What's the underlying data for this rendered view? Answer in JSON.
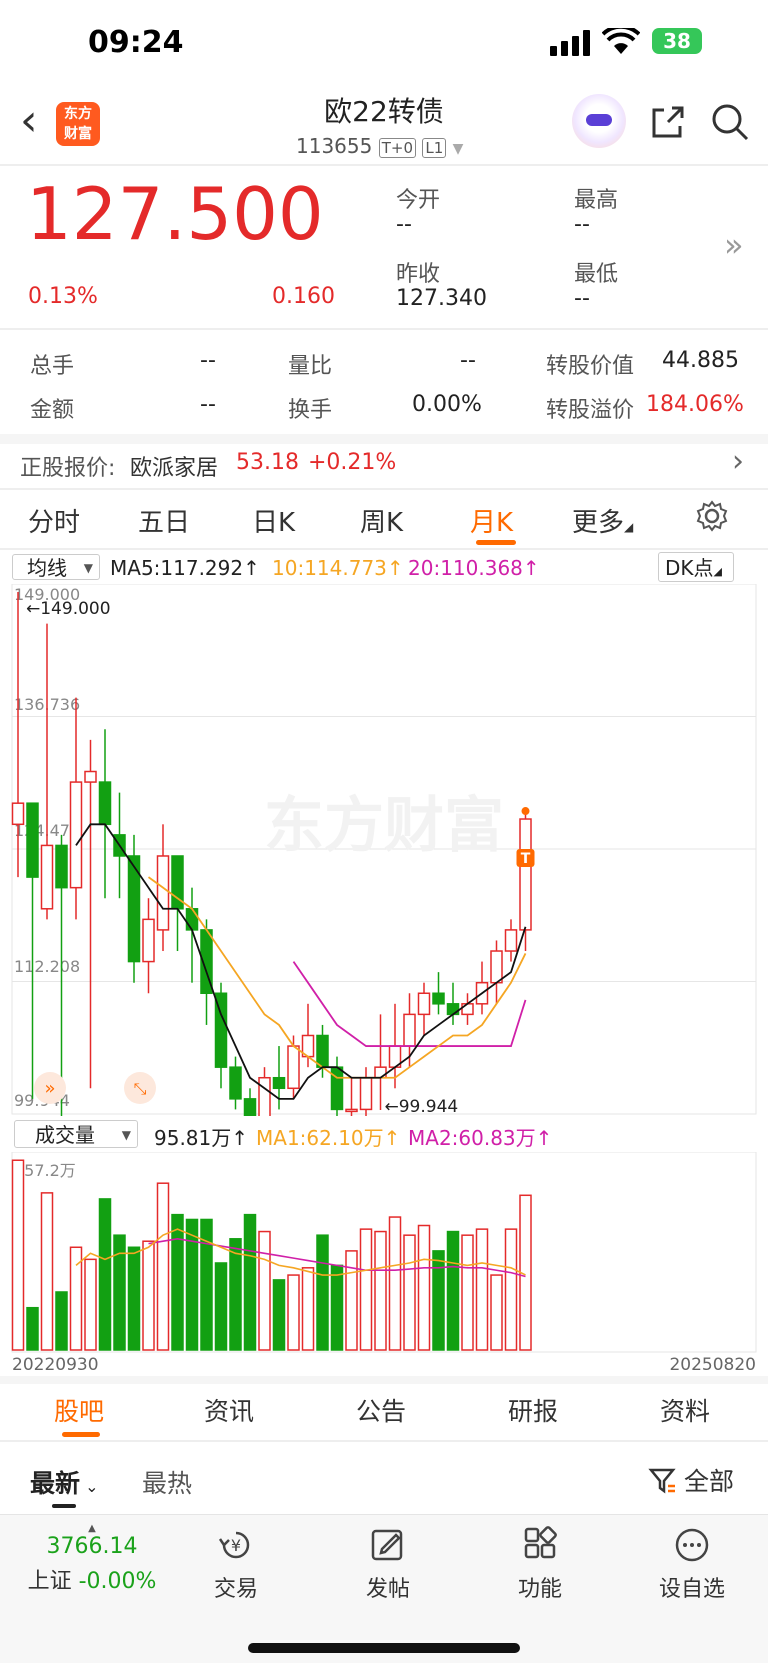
{
  "status_bar": {
    "time": "09:24",
    "battery": "38"
  },
  "header": {
    "title": "欧22转债",
    "code": "113655",
    "badge1": "T+0",
    "badge2": "L1",
    "logo_line1": "东方",
    "logo_line2": "财富"
  },
  "quote": {
    "price": "127.500",
    "pct": "0.13%",
    "change": "0.160",
    "open_label": "今开",
    "open": "--",
    "high_label": "最高",
    "high": "--",
    "prev_label": "昨收",
    "prev": "127.340",
    "low_label": "最低",
    "low": "--"
  },
  "stats": {
    "vol_label": "总手",
    "vol": "--",
    "ratio_label": "量比",
    "ratio": "--",
    "conv_value_label": "转股价值",
    "conv_value": "44.885",
    "amount_label": "金额",
    "amount": "--",
    "turnover_label": "换手",
    "turnover": "0.00%",
    "premium_label": "转股溢价",
    "premium": "184.06%"
  },
  "stock": {
    "label": "正股报价:",
    "name": "欧派家居",
    "price": "53.18",
    "change": "+0.21%"
  },
  "chart_tabs": [
    "分时",
    "五日",
    "日K",
    "周K",
    "月K",
    "更多"
  ],
  "ma_bar": {
    "select": "均线",
    "ma5": "MA5:117.292↑",
    "ma10": "10:114.773↑",
    "ma20": "20:110.368↑",
    "dk": "DK点"
  },
  "vol_bar": {
    "select": "成交量",
    "vol": "95.81万↑",
    "ma1": "MA1:62.10万↑",
    "ma2": "MA2:60.83万↑"
  },
  "colors": {
    "up": "#e42a2a",
    "down": "#12a012",
    "ma5": "#111111",
    "ma10": "#f5a623",
    "ma20": "#d020a8",
    "accent": "#ff6a00"
  },
  "chart_data": {
    "type": "candlestick",
    "yaxis_labels": [
      "149.000",
      "136.736",
      "124.472",
      "112.208",
      "99.944"
    ],
    "max_label": "149.000",
    "min_label": "99.944",
    "ylim": [
      99.944,
      149.0
    ],
    "start_date": "20220930",
    "end_date": "20250820",
    "vol_max_label": "157.2万",
    "candles": [
      {
        "o": 127,
        "c": 129,
        "h": 149,
        "l": 122
      },
      {
        "o": 129,
        "c": 122,
        "h": 128,
        "l": 101
      },
      {
        "o": 119,
        "c": 125,
        "h": 146,
        "l": 118
      },
      {
        "o": 125,
        "c": 121,
        "h": 126,
        "l": 99
      },
      {
        "o": 121,
        "c": 131,
        "h": 139,
        "l": 118
      },
      {
        "o": 131,
        "c": 132,
        "h": 135,
        "l": 102
      },
      {
        "o": 131,
        "c": 127,
        "h": 136,
        "l": 120
      },
      {
        "o": 126,
        "c": 124,
        "h": 130,
        "l": 120
      },
      {
        "o": 124,
        "c": 114,
        "h": 126,
        "l": 112
      },
      {
        "o": 114,
        "c": 118,
        "h": 120,
        "l": 111
      },
      {
        "o": 117,
        "c": 124,
        "h": 127,
        "l": 115
      },
      {
        "o": 124,
        "c": 119,
        "h": 124,
        "l": 115
      },
      {
        "o": 119,
        "c": 117,
        "h": 121,
        "l": 112
      },
      {
        "o": 117,
        "c": 111,
        "h": 118,
        "l": 108
      },
      {
        "o": 111,
        "c": 104,
        "h": 112,
        "l": 102
      },
      {
        "o": 104,
        "c": 101,
        "h": 105,
        "l": 100
      },
      {
        "o": 101,
        "c": 99,
        "h": 102,
        "l": 97
      },
      {
        "o": 99,
        "c": 103,
        "h": 104,
        "l": 98
      },
      {
        "o": 103,
        "c": 102,
        "h": 106,
        "l": 100
      },
      {
        "o": 102,
        "c": 106,
        "h": 107,
        "l": 101
      },
      {
        "o": 105,
        "c": 107,
        "h": 110,
        "l": 104
      },
      {
        "o": 107,
        "c": 104,
        "h": 108,
        "l": 103
      },
      {
        "o": 104,
        "c": 100,
        "h": 105,
        "l": 98
      },
      {
        "o": 100,
        "c": 100,
        "h": 103,
        "l": 99
      },
      {
        "o": 100,
        "c": 103,
        "h": 104,
        "l": 98
      },
      {
        "o": 103,
        "c": 104,
        "h": 109,
        "l": 99.944
      },
      {
        "o": 104,
        "c": 106,
        "h": 110,
        "l": 102
      },
      {
        "o": 106,
        "c": 109,
        "h": 111,
        "l": 104
      },
      {
        "o": 109,
        "c": 111,
        "h": 112,
        "l": 107
      },
      {
        "o": 111,
        "c": 110,
        "h": 113,
        "l": 109
      },
      {
        "o": 110,
        "c": 109,
        "h": 112,
        "l": 108
      },
      {
        "o": 109,
        "c": 110,
        "h": 111,
        "l": 108
      },
      {
        "o": 110,
        "c": 112,
        "h": 114,
        "l": 109
      },
      {
        "o": 112,
        "c": 115,
        "h": 116,
        "l": 110
      },
      {
        "o": 115,
        "c": 117,
        "h": 118,
        "l": 114
      },
      {
        "o": 117,
        "c": 127.5,
        "h": 128,
        "l": 115
      }
    ],
    "volumes": [
      157,
      35,
      130,
      48,
      85,
      75,
      125,
      95,
      85,
      90,
      138,
      112,
      108,
      108,
      72,
      92,
      112,
      98,
      58,
      62,
      68,
      95,
      70,
      82,
      100,
      98,
      110,
      95,
      103,
      82,
      98,
      95,
      100,
      62,
      100,
      128
    ],
    "ma5": [
      null,
      null,
      null,
      null,
      125,
      127,
      127,
      125,
      123,
      121,
      119,
      119,
      117,
      113,
      109,
      106,
      103,
      102,
      101,
      101,
      103,
      104,
      104,
      103,
      103,
      103,
      104,
      105,
      107,
      108,
      109,
      110,
      111,
      112,
      113,
      117.292
    ],
    "ma10": [
      null,
      null,
      null,
      null,
      null,
      null,
      null,
      null,
      null,
      122,
      121,
      120,
      119,
      117,
      115,
      113,
      111,
      109,
      108,
      106,
      105,
      104,
      103,
      103,
      103,
      103,
      103,
      104,
      105,
      106,
      107,
      107,
      108,
      110,
      112,
      114.773
    ],
    "ma20": [
      null,
      null,
      null,
      null,
      null,
      null,
      null,
      null,
      null,
      null,
      null,
      null,
      null,
      null,
      null,
      null,
      null,
      null,
      null,
      114,
      112,
      110,
      108,
      107,
      106,
      106,
      106,
      106,
      106,
      106,
      106,
      106,
      106,
      106,
      106,
      110.368
    ],
    "vol_ma1": [
      null,
      null,
      null,
      null,
      70,
      80,
      75,
      80,
      80,
      85,
      95,
      100,
      95,
      90,
      85,
      80,
      78,
      75,
      70,
      68,
      65,
      62,
      62,
      64,
      66,
      68,
      70,
      72,
      75,
      74,
      72,
      70,
      72,
      70,
      68,
      62.1
    ],
    "vol_ma2": [
      null,
      null,
      null,
      null,
      null,
      null,
      null,
      null,
      null,
      88,
      90,
      92,
      90,
      88,
      86,
      84,
      82,
      80,
      78,
      76,
      74,
      72,
      70,
      68,
      66,
      66,
      66,
      67,
      68,
      68,
      69,
      68,
      68,
      66,
      64,
      60.83
    ]
  },
  "bottom_tabs": [
    "股吧",
    "资讯",
    "公告",
    "研报",
    "资料"
  ],
  "sort": {
    "latest": "最新",
    "hot": "最热",
    "filter": "全部"
  },
  "dock": {
    "index_value": "3766.14",
    "index_name": "上证",
    "index_change": "-0.00%",
    "trade": "交易",
    "post": "发帖",
    "func": "功能",
    "watch": "设自选"
  },
  "watermark": "东方财富"
}
